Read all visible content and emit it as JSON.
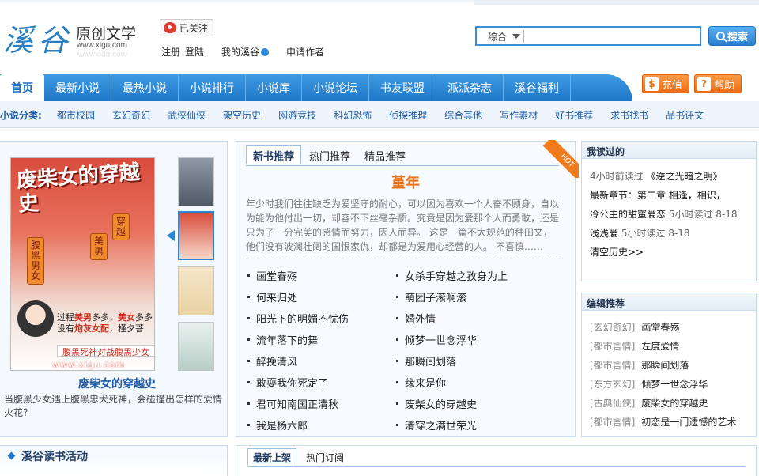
{
  "header": {
    "logo": "溪谷",
    "site_title": "原创文学",
    "site_url": "www.xigu.com",
    "weibo_follow": "已关注",
    "register": "注册",
    "login": "登陆",
    "my_xigu": "我的溪谷",
    "apply_author": "申请作者",
    "search_scope": "综合",
    "search_placeholder": "",
    "search_button": "搜索"
  },
  "nav": {
    "items": [
      "首页",
      "最新小说",
      "最热小说",
      "小说排行",
      "小说库",
      "小说论坛",
      "书友联盟",
      "派派杂志",
      "溪谷福利"
    ],
    "recharge": "充值",
    "help": "帮助"
  },
  "categories": {
    "label": "小说分类:",
    "items": [
      "都市校园",
      "玄幻奇幻",
      "武侠仙侠",
      "架空历史",
      "网游竞技",
      "科幻恐怖",
      "侦探推理",
      "综合其他",
      "写作素材",
      "好书推荐",
      "求书找书",
      "品书评文"
    ]
  },
  "featured": {
    "cover_title": "废柴女的穿越史",
    "cover_tags": [
      "腹黑男女",
      "美男",
      "穿越"
    ],
    "cover_line1_pre": "过程",
    "cover_line1_hl1": "美男",
    "cover_line1_mid": "多多，",
    "cover_line1_hl2": "美女",
    "cover_line1_post": "多多",
    "cover_line2_pre": "没有",
    "cover_line2_hl": "炮灰女配",
    "cover_line2_post": "，槿夕菩",
    "cover_banner": "腹黑死神对战腹黑少女",
    "cover_url": "www.xigu.com",
    "title": "废柴女的穿越史",
    "description": "当腹黑少女遇上腹黑忠犬死神，会碰撞出怎样的爱情火花？"
  },
  "recommend": {
    "tabs": [
      "新书推荐",
      "热门推荐",
      "精品推荐"
    ],
    "hot_badge": "HOT",
    "headline": "堇年",
    "summary": "年少时我们往往缺乏为爱坚守的耐心，可以因为喜欢一个人奋不顾身，自以为能为他付出一切，却容不下丝毫杂质。究竟是因为爱那个人而勇敢，还是只为了一分完美的感情而努力，因人而异。 这是一篇不太规范的种田文，他们没有波澜壮阔的国恨家仇，却都是为爱用心经营的人。 不喜慎……",
    "list_left": [
      "画堂春殇",
      "何来归处",
      "阳光下的明媚不忧伤",
      "流年落下的舞",
      "醉挽清风",
      "敢耍我你死定了",
      "君可知南国正清秋",
      "我是杨六郎"
    ],
    "list_right": [
      "女杀手穿越之孜身为上",
      "萌团子滚啊滚",
      "婚外情",
      "倾梦一世念浮华",
      "那瞬间划落",
      "缘来是你",
      "废柴女的穿越史",
      "清穿之满世荣光"
    ]
  },
  "my_reading": {
    "title": "我读过的",
    "entries": [
      {
        "time": "4小时前读过",
        "book": "《逆之光暗之明》"
      },
      {
        "latest": "最新章节：第二章 相逢，相识，"
      },
      {
        "book": "冷公主的甜蜜爱恋",
        "time": "5小时读过",
        "chapter": "8-18"
      },
      {
        "book": "浅浅爱",
        "time": "5小时读过",
        "chapter": "8-18"
      }
    ],
    "clear": "清空历史>>"
  },
  "editor_picks": {
    "title": "编辑推荐",
    "items": [
      {
        "genre": "[玄幻奇幻]",
        "book": "画堂春殇"
      },
      {
        "genre": "[都市言情]",
        "book": "左度爱情"
      },
      {
        "genre": "[都市言情]",
        "book": "那瞬间划落"
      },
      {
        "genre": "[东方玄幻]",
        "book": "倾梦一世念浮华"
      },
      {
        "genre": "[古典仙侠]",
        "book": "废柴女的穿越史"
      },
      {
        "genre": "[都市言情]",
        "book": "初恋是一门遗憾的艺术"
      }
    ]
  },
  "bottom": {
    "activity_title": "溪谷读书活动",
    "tabs": [
      "最新上架",
      "热门订阅"
    ]
  },
  "colors": {
    "nav_blue": "#2b85d6",
    "orange": "#ec6b13",
    "link_blue": "#1f5aa6"
  }
}
